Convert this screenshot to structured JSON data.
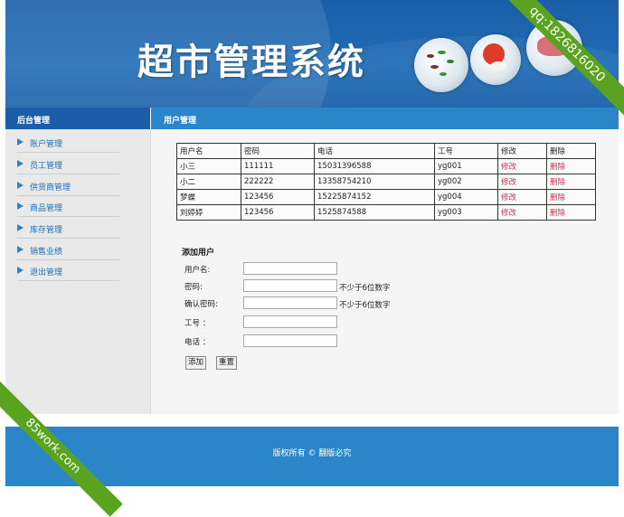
{
  "header": {
    "title": "超市管理系统"
  },
  "subbar": {
    "left_title": "后台管理",
    "right_title": "用户管理"
  },
  "sidebar": {
    "items": [
      {
        "label": "账户管理"
      },
      {
        "label": "员工管理"
      },
      {
        "label": "供货商管理"
      },
      {
        "label": "商品管理"
      },
      {
        "label": "库存管理"
      },
      {
        "label": "销售业绩"
      },
      {
        "label": "退出管理"
      }
    ]
  },
  "table": {
    "headers": [
      "用户名",
      "密码",
      "电话",
      "工号",
      "修改",
      "删除"
    ],
    "rows": [
      [
        "小三",
        "111111",
        "15031396588",
        "yg001",
        "修改",
        "删除"
      ],
      [
        "小二",
        "222222",
        "13358754210",
        "yg002",
        "修改",
        "删除"
      ],
      [
        "梦蝶",
        "123456",
        "15225874152",
        "yg004",
        "修改",
        "删除"
      ],
      [
        "刘婷婷",
        "123456",
        "1525874588",
        "yg003",
        "修改",
        "删除"
      ]
    ]
  },
  "form": {
    "title": "添加用户",
    "username_label": "用户名:",
    "password_label": "密码:",
    "password_hint": "不少于6位数字",
    "confirm_label": "确认密码:",
    "confirm_hint": "不少于6位数字",
    "empno_label": "工号 ：",
    "phone_label": "电话 ：",
    "username_value": "",
    "password_value": "",
    "confirm_value": "",
    "empno_value": "",
    "phone_value": "",
    "add_button": "添加",
    "reset_button": "重置"
  },
  "footer": {
    "copyright": "版权所有 © 翻版必究"
  },
  "watermarks": {
    "top_right": "qq:1826816020",
    "bottom_left": "85work.com"
  },
  "colors": {
    "header_blue": "#1f6cb6",
    "bar_blue": "#2a86c8",
    "link_red": "#d0304a",
    "ribbon_green": "#5aa321"
  }
}
